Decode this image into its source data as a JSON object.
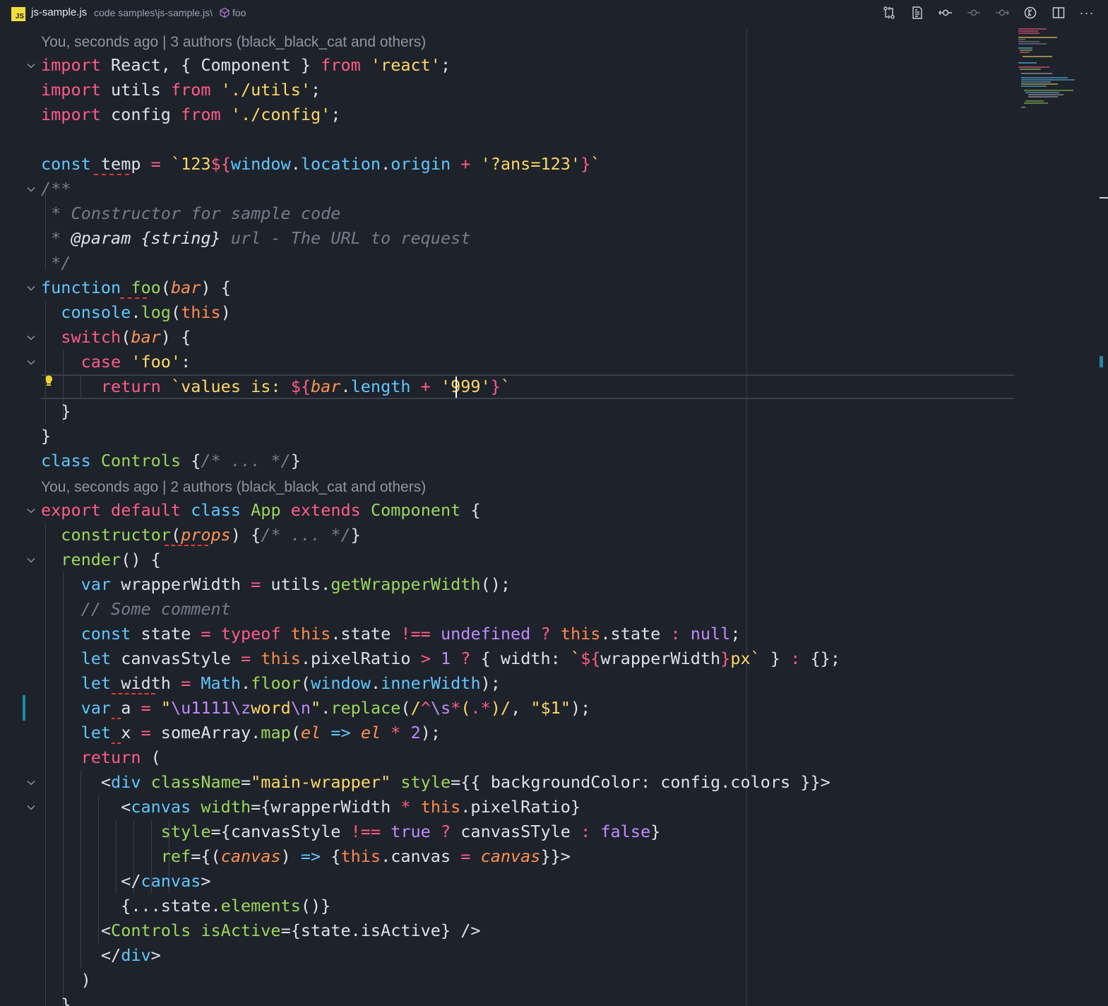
{
  "breadcrumb": {
    "file_icon_text": "JS",
    "file": "js-sample.js",
    "path": "code samples\\js-sample.js\\",
    "symbol": "foo"
  },
  "toolbar": {
    "buttons": [
      "compare-changes-icon",
      "open-preview-icon",
      "git-commit-icon",
      "previous-change-icon",
      "next-change-icon",
      "git-lens-icon",
      "split-editor-icon",
      "more-actions-icon"
    ],
    "more_label": "···"
  },
  "codelens": {
    "first": "You, seconds ago | 3 authors (black_black_cat and others)",
    "second": "You, seconds ago | 2 authors (black_black_cat and others)"
  },
  "colors": {
    "background": "#1e222a",
    "keyword": "#ff5c8a",
    "string": "#ffd866",
    "function": "#9cd85c",
    "storage": "#5fc8ff",
    "parameter": "#fd9353",
    "number": "#bf8cff",
    "comment": "#757d8a",
    "error_squiggle": "#e23838",
    "modified_gutter": "#1f8aa5"
  },
  "code_lines": [
    "import React, { Component } from 'react';",
    "import utils from './utils';",
    "import config from './config';",
    "",
    "const temp = `123${window.location.origin + '?ans=123'}`",
    "/**",
    " * Constructor for sample code",
    " * @param {string} url - The URL to request",
    " */",
    "function foo(bar) {",
    "  console.log(this)",
    "  switch(bar) {",
    "    case 'foo':",
    "      return `values is: ${bar.length + '999'}`",
    "  }",
    "}",
    "class Controls {/* ... */}",
    "export default class App extends Component {",
    "  constructor(props) {/* ... */}",
    "  render() {",
    "    var wrapperWidth = utils.getWrapperWidth();",
    "    // Some comment",
    "    const state = typeof this.state !== undefined ? this.state : null;",
    "    let canvasStyle = this.pixelRatio > 1 ? { width: `${wrapperWidth}px` } : {};",
    "    let width = Math.floor(window.innerWidth);",
    "    var a = \"\\u1111\\zword\\n\".replace(/^\\s*(.*)/, \"$1\");",
    "    let x = someArray.map(el => el * 2);",
    "    return (",
    "      <div className=\"main-wrapper\" style={{ backgroundColor: config.colors }}>",
    "        <canvas width={wrapperWidth * this.pixelRatio}",
    "            style={canvasStyle !== true ? canvasSTyle : false}",
    "            ref={(canvas) => {this.canvas = canvas}}>",
    "        </canvas>",
    "        {...state.elements()}",
    "      <Controls isActive={state.isActive} />",
    "      </div>",
    "    )",
    "  }"
  ]
}
